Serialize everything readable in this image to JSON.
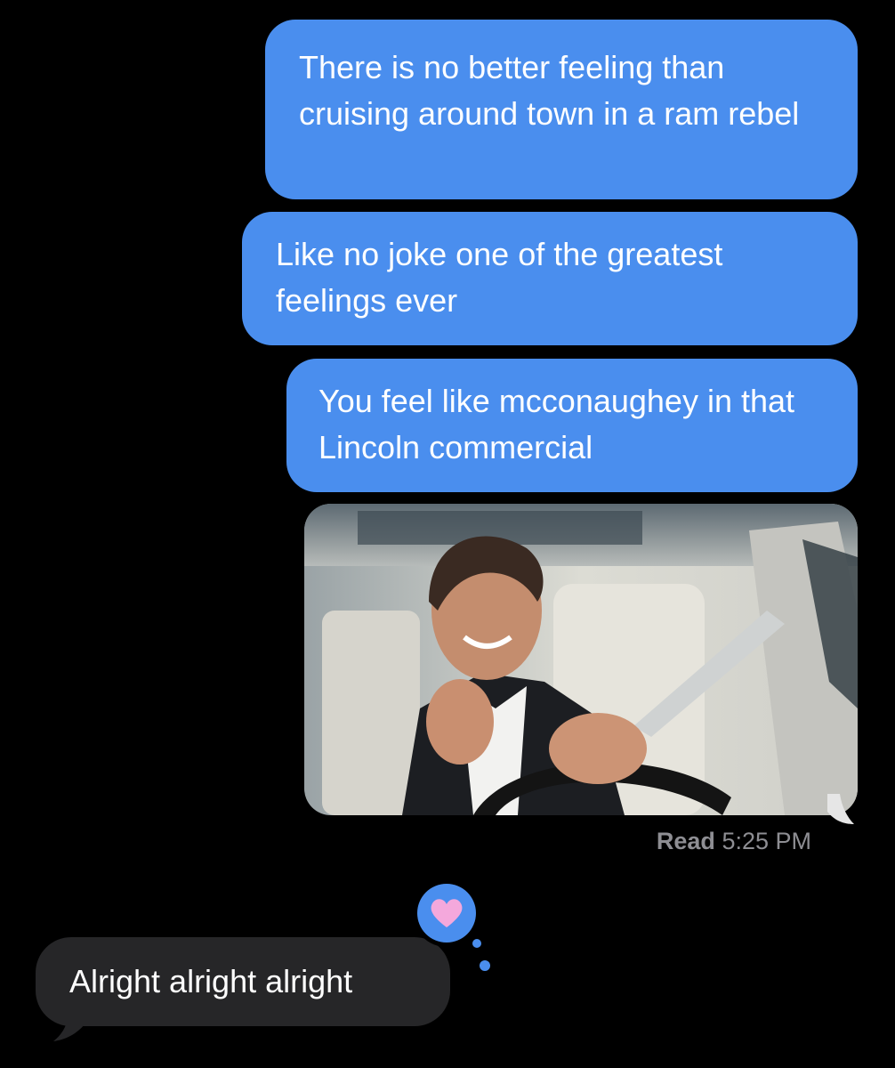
{
  "messages": {
    "sent_1": "There is no better feeling than cruising around town in a ram rebel",
    "sent_2": "Like no joke one of the greatest feelings ever",
    "sent_3": "You feel like mcconaughey in that Lincoln commercial",
    "received_1": "Alright alright alright"
  },
  "attachment": {
    "alt": "photo"
  },
  "receipt": {
    "status": "Read",
    "time": "5:25 PM"
  },
  "tapback": {
    "reaction": "heart-icon"
  },
  "colors": {
    "background": "#000000",
    "sent_bubble": "#4a8eee",
    "received_bubble": "#262628",
    "tapback_heart": "#f4a8dc",
    "receipt_text": "#8e8e93"
  }
}
